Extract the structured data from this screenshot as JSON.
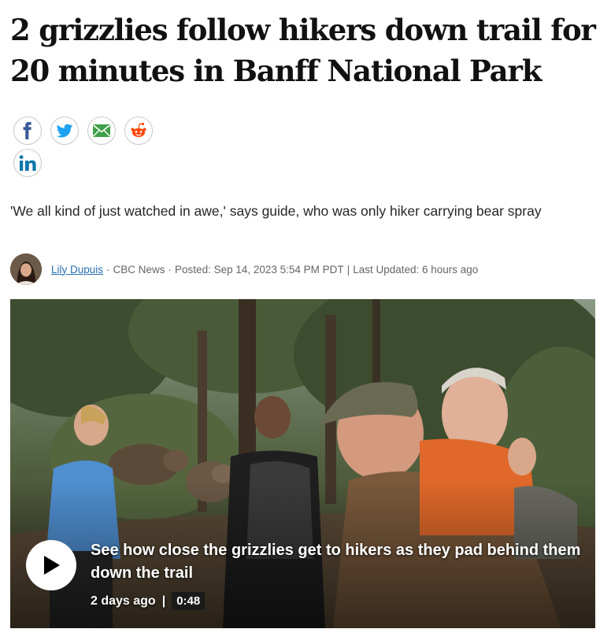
{
  "article": {
    "headline": "2 grizzlies follow hikers down trail for 20 minutes in Banff National Park",
    "deck": "'We all kind of just watched in awe,' says guide, who was only hiker carrying bear spray"
  },
  "share": {
    "icons": [
      "facebook-icon",
      "twitter-icon",
      "email-icon",
      "reddit-icon",
      "linkedin-icon"
    ]
  },
  "byline": {
    "author": "Lily Dupuis",
    "separator": "·",
    "outlet": "CBC News",
    "posted": "Posted: Sep 14, 2023 5:54 PM PDT",
    "pipe": "|",
    "updated": "Last Updated: 6 hours ago"
  },
  "video": {
    "caption": "See how close the grizzlies get to hikers as they pad behind them down the trail",
    "age": "2 days ago",
    "pipe": "|",
    "duration": "0:48"
  },
  "colors": {
    "facebook": "#3b5998",
    "twitter": "#1da1f2",
    "email": "#3fa049",
    "reddit": "#ff4500",
    "linkedin": "#0e76a8",
    "author_link": "#2a6fb0"
  }
}
